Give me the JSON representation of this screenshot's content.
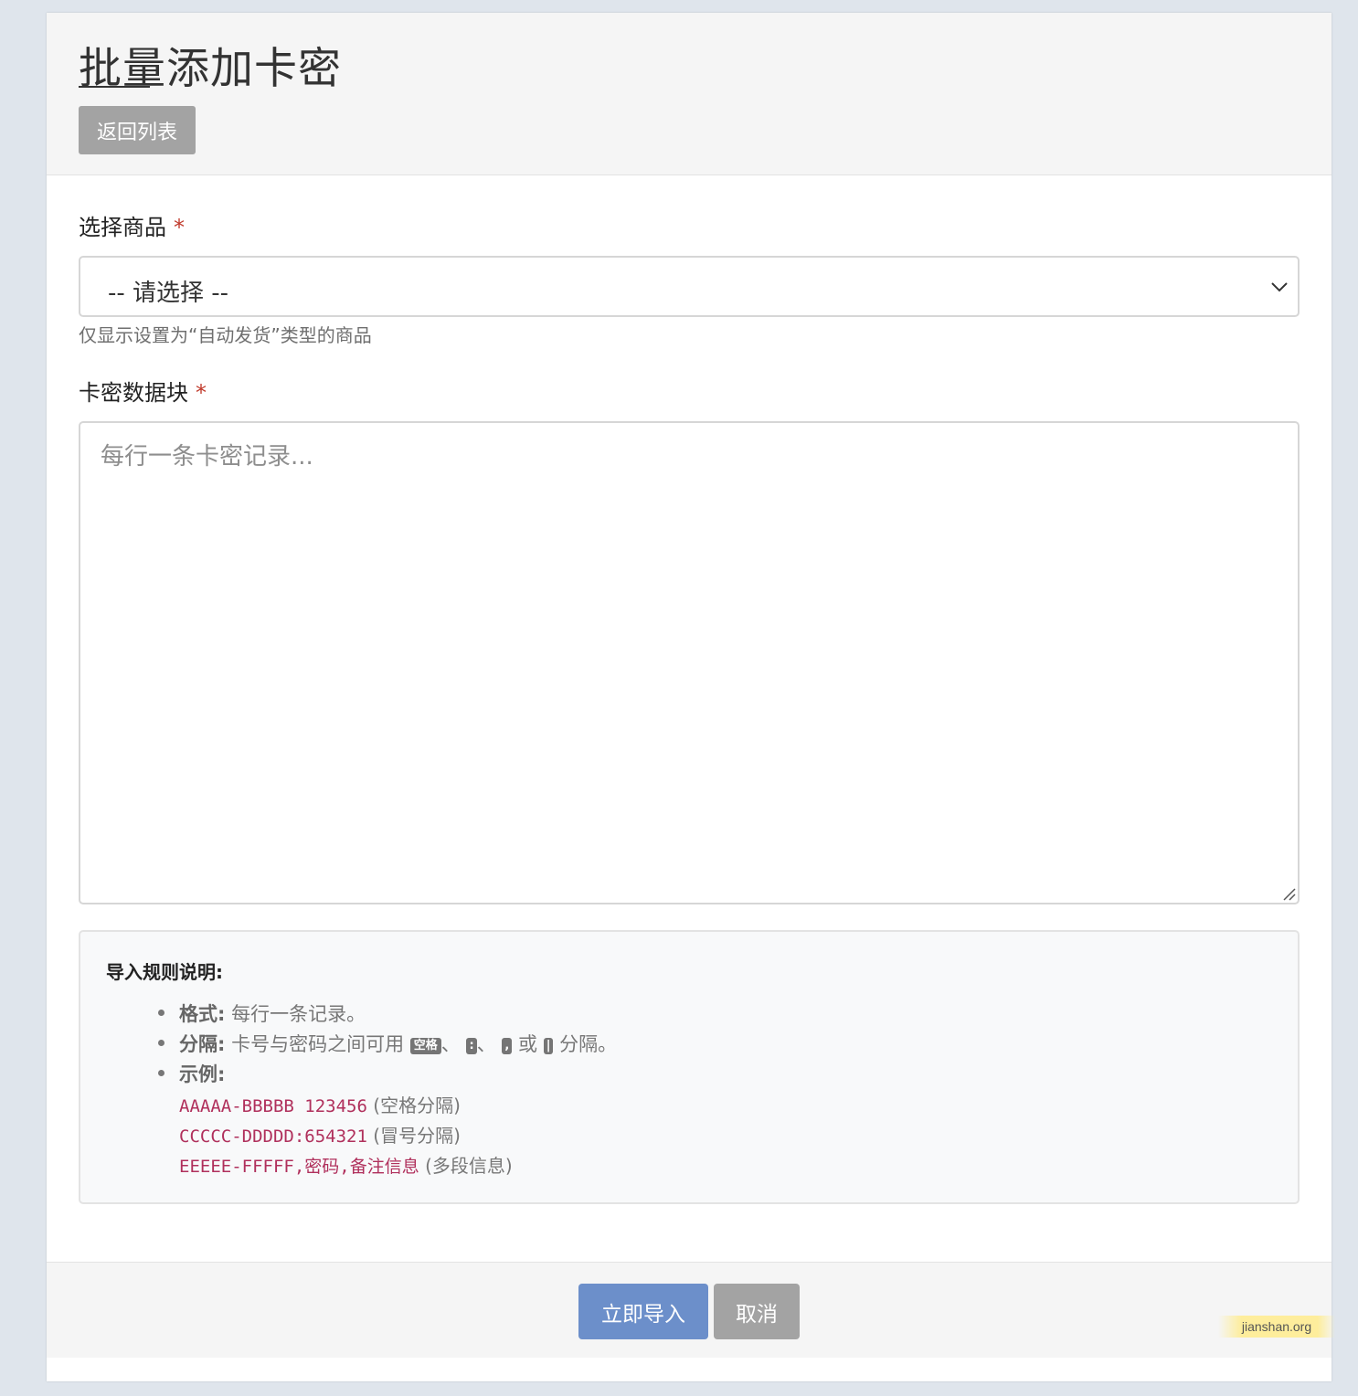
{
  "header": {
    "title": "批量添加卡密",
    "back_button": "返回列表"
  },
  "form": {
    "product_label": "选择商品",
    "required_mark": "*",
    "product_select_value": "-- 请选择 --",
    "product_help": "仅显示设置为“自动发货”类型的商品",
    "cards_label": "卡密数据块",
    "cards_placeholder": "每行一条卡密记录..."
  },
  "rules": {
    "title": "导入规则说明:",
    "format_key": "格式:",
    "format_text": "每行一条记录。",
    "separator_key": "分隔:",
    "separator_text": "卡号与密码之间可用",
    "separator_space": "空格",
    "separator_colon": ":",
    "separator_comma": ",",
    "separator_pipe": "|",
    "separator_or": "或",
    "separator_tail": "分隔。",
    "dun": "、",
    "example_key": "示例:",
    "examples": [
      {
        "code": "AAAAA-BBBBB 123456",
        "note": "(空格分隔)"
      },
      {
        "code": "CCCCC-DDDDD:654321",
        "note": "(冒号分隔)"
      },
      {
        "code": "EEEEE-FFFFF,密码,备注信息",
        "note": "(多段信息)"
      }
    ]
  },
  "footer": {
    "submit_button": "立即导入",
    "cancel_button": "取消"
  },
  "watermark": "jianshan.org",
  "colors": {
    "primary": "#6c8fca",
    "secondary": "#a3a3a3",
    "required": "#c0392b",
    "code": "#b0305c"
  }
}
